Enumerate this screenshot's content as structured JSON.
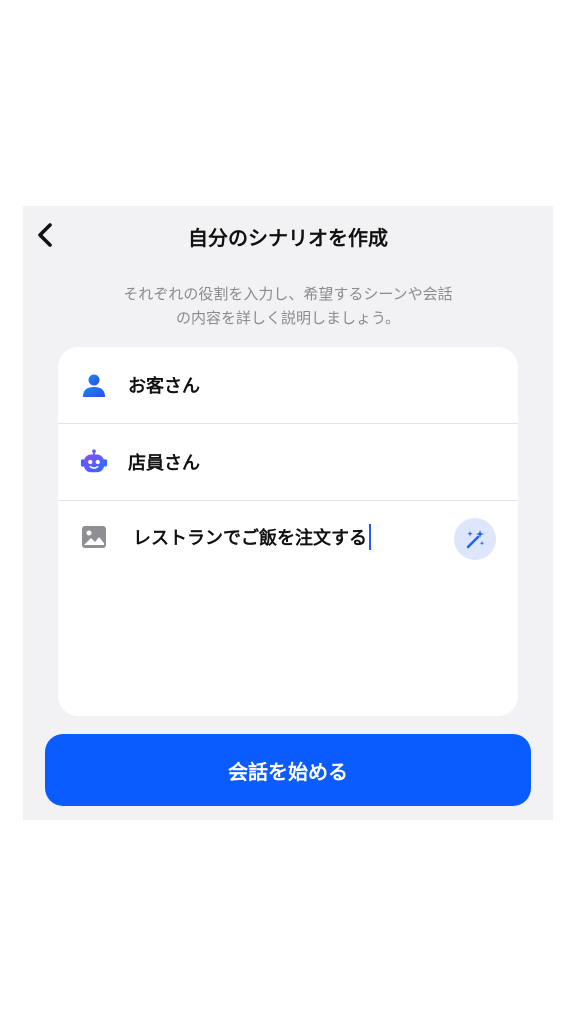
{
  "header": {
    "title": "自分のシナリオを作成",
    "back_icon": "chevron-left-icon"
  },
  "description": {
    "line1": "それぞれの役割を入力し、希望するシーンや会話",
    "line2": "の内容を詳しく説明しましょう。"
  },
  "roles": [
    {
      "icon": "user-icon",
      "label": "お客さん"
    },
    {
      "icon": "robot-icon",
      "label": "店員さん"
    }
  ],
  "scenario": {
    "icon": "image-icon",
    "value": "レストランでご飯を注文する",
    "magic_icon": "magic-wand-icon"
  },
  "start_button": {
    "label": "会話を始める"
  },
  "colors": {
    "accent": "#0b5cff",
    "background": "#f2f2f4",
    "card": "#ffffff",
    "muted_text": "#8a8a90"
  }
}
